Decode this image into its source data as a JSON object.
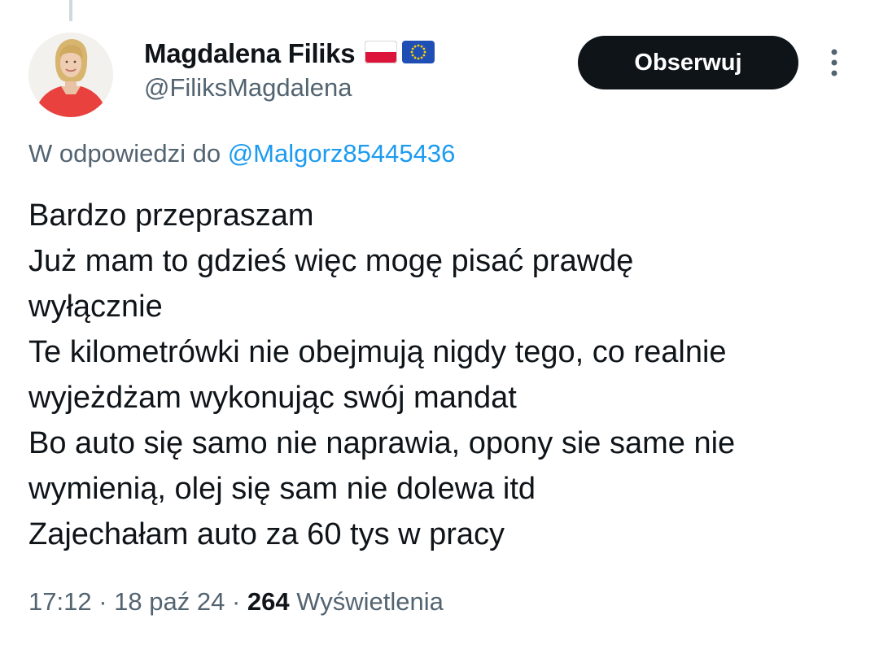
{
  "author": {
    "display_name": "Magdalena Filiks",
    "handle": "@FiliksMagdalena",
    "flags": [
      "poland-flag-icon",
      "eu-flag-icon"
    ]
  },
  "follow_button": {
    "label": "Obserwuj"
  },
  "more_menu": {
    "icon": "more-vertical-icon"
  },
  "reply_context": {
    "prefix": "W odpowiedzi do",
    "handle": "@Malgorz85445436"
  },
  "tweet": {
    "lines": [
      "Bardzo przepraszam",
      "Już mam to gdzieś więc mogę pisać prawdę",
      "wyłącznie",
      "Te kilometrówki nie obejmują nigdy tego, co realnie",
      "wyjeżdżam wykonując swój mandat",
      "Bo auto się samo nie naprawia, opony sie same nie",
      "wymienią, olej się sam nie dolewa itd",
      "Zajechałam auto za 60 tys w pracy"
    ]
  },
  "meta": {
    "time": "17:12",
    "separator": "·",
    "date": "18 paź 24",
    "views_count": "264",
    "views_label": "Wyświetlenia"
  },
  "colors": {
    "text_primary": "#0f1419",
    "text_secondary": "#536471",
    "link": "#1d9bf0",
    "button_bg": "#0f1419",
    "thread_line": "#cfd9de"
  }
}
